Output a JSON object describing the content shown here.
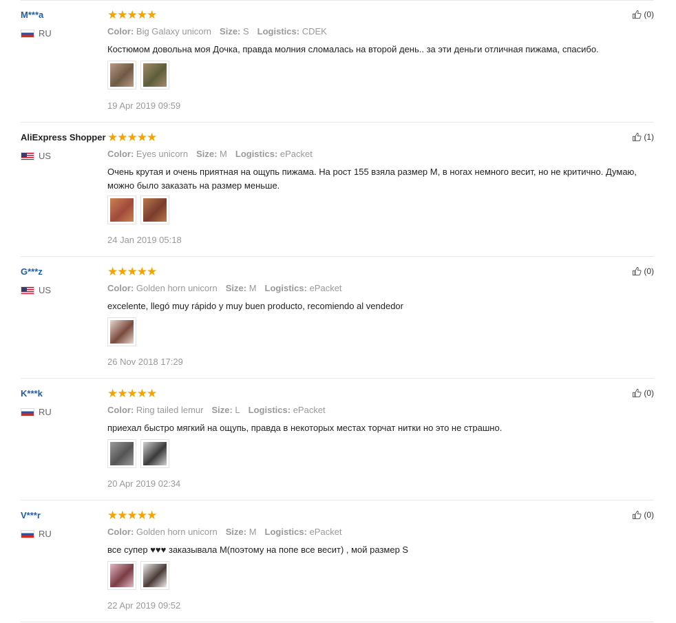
{
  "reviews": [
    {
      "user": "M***a",
      "country": "RU",
      "flag": "ru",
      "stars": "★★★★★",
      "color_label": "Color:",
      "color": "Big Galaxy unicorn",
      "size_label": "Size:",
      "size": "S",
      "logistics_label": "Logistics:",
      "logistics": "CDEK",
      "text": "Костюмом довольна моя Дочка, правда молния сломалась на второй день.. за эти деньги отличная пижама, спасибо.",
      "date": "19 Apr 2019 09:59",
      "likes": "(0)",
      "photos": [
        {
          "colors": [
            "#b79a86",
            "#6f5a45"
          ]
        },
        {
          "colors": [
            "#a48b6b",
            "#5c5d3a"
          ]
        }
      ]
    },
    {
      "user": "AliExpress Shopper",
      "country": "US",
      "flag": "us",
      "stars": "★★★★★",
      "color_label": "Color:",
      "color": "Eyes unicorn",
      "size_label": "Size:",
      "size": "M",
      "logistics_label": "Logistics:",
      "logistics": "ePacket",
      "text": "Очень крутая и очень приятная на ощупь пижама. На рост 155 взяла размер М, в ногах немного весит, но не критично. Думаю, можно было заказать на размер меньше.",
      "date": "24 Jan 2019 05:18",
      "likes": "(1)",
      "photos": [
        {
          "colors": [
            "#c9834f",
            "#a04a3c"
          ]
        },
        {
          "colors": [
            "#b9784b",
            "#7a3c2d"
          ]
        }
      ]
    },
    {
      "user": "G***z",
      "country": "US",
      "flag": "us",
      "stars": "★★★★★",
      "color_label": "Color:",
      "color": "Golden horn unicorn",
      "size_label": "Size:",
      "size": "M",
      "logistics_label": "Logistics:",
      "logistics": "ePacket",
      "text": "excelente, llegó muy rápido y muy buen producto, recomiendo al vendedor",
      "date": "26 Nov 2018 17:29",
      "likes": "(0)",
      "photos": [
        {
          "colors": [
            "#e7d6cc",
            "#7a4a3e"
          ]
        }
      ]
    },
    {
      "user": "K***k",
      "country": "RU",
      "flag": "ru",
      "stars": "★★★★★",
      "color_label": "Color:",
      "color": "Ring tailed lemur",
      "size_label": "Size:",
      "size": "L",
      "logistics_label": "Logistics:",
      "logistics": "ePacket",
      "text": "приехал быстро мягкий на ощупь, правда в некоторых местах торчат нитки но это не страшно.",
      "date": "20 Apr 2019 02:34",
      "likes": "(0)",
      "photos": [
        {
          "colors": [
            "#9a9a9a",
            "#555"
          ]
        },
        {
          "colors": [
            "#d0d0d0",
            "#3a3a3a"
          ]
        }
      ]
    },
    {
      "user": "V***r",
      "country": "RU",
      "flag": "ru",
      "stars": "★★★★★",
      "color_label": "Color:",
      "color": "Golden horn unicorn",
      "size_label": "Size:",
      "size": "M",
      "logistics_label": "Logistics:",
      "logistics": "ePacket",
      "text": "все супер ♥♥♥ заказывала М(поэтому на попе все весит) , мой размер S",
      "date": "22 Apr 2019 09:52",
      "likes": "(0)",
      "photos": [
        {
          "colors": [
            "#e2b9c4",
            "#7a3b44"
          ]
        },
        {
          "colors": [
            "#eee",
            "#4a3a35"
          ]
        }
      ]
    }
  ]
}
